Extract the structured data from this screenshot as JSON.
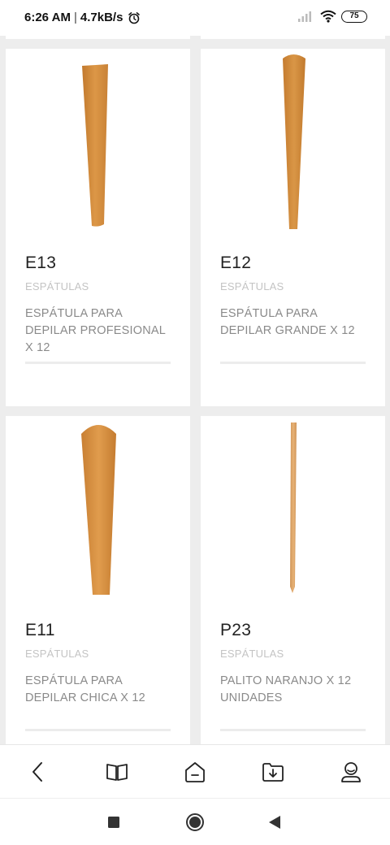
{
  "status_bar": {
    "time": "6:26 AM",
    "separator": "|",
    "network_speed": "4.7kB/s",
    "battery": "75",
    "icons": [
      "alarm-icon",
      "signal-icon",
      "wifi-icon",
      "battery-icon"
    ]
  },
  "products": [
    {
      "code": "E13",
      "category": "ESPÁTULAS",
      "description": "ESPÁTULA PARA DEPILAR PROFESIONAL X 12"
    },
    {
      "code": "E12",
      "category": "ESPÁTULAS",
      "description": "ESPÁTULA PARA DEPILAR GRANDE X 12"
    },
    {
      "code": "E11",
      "category": "ESPÁTULAS",
      "description": "ESPÁTULA PARA DEPILAR CHICA X 12"
    },
    {
      "code": "P23",
      "category": "ESPÁTULAS",
      "description": "PALITO NARANJO X 12 UNIDADES"
    }
  ],
  "bottom_nav": {
    "icons": [
      "back-icon",
      "book-icon",
      "home-icon",
      "download-folder-icon",
      "profile-icon"
    ]
  },
  "system_nav": {
    "icons": [
      "recents-square-icon",
      "home-circle-icon",
      "back-triangle-icon"
    ]
  },
  "colors": {
    "background": "#ededed",
    "card": "#ffffff",
    "wood": "#d08a3b",
    "code_text": "#222222",
    "category_text": "#c4c4c4",
    "desc_text": "#8a8a8a"
  }
}
